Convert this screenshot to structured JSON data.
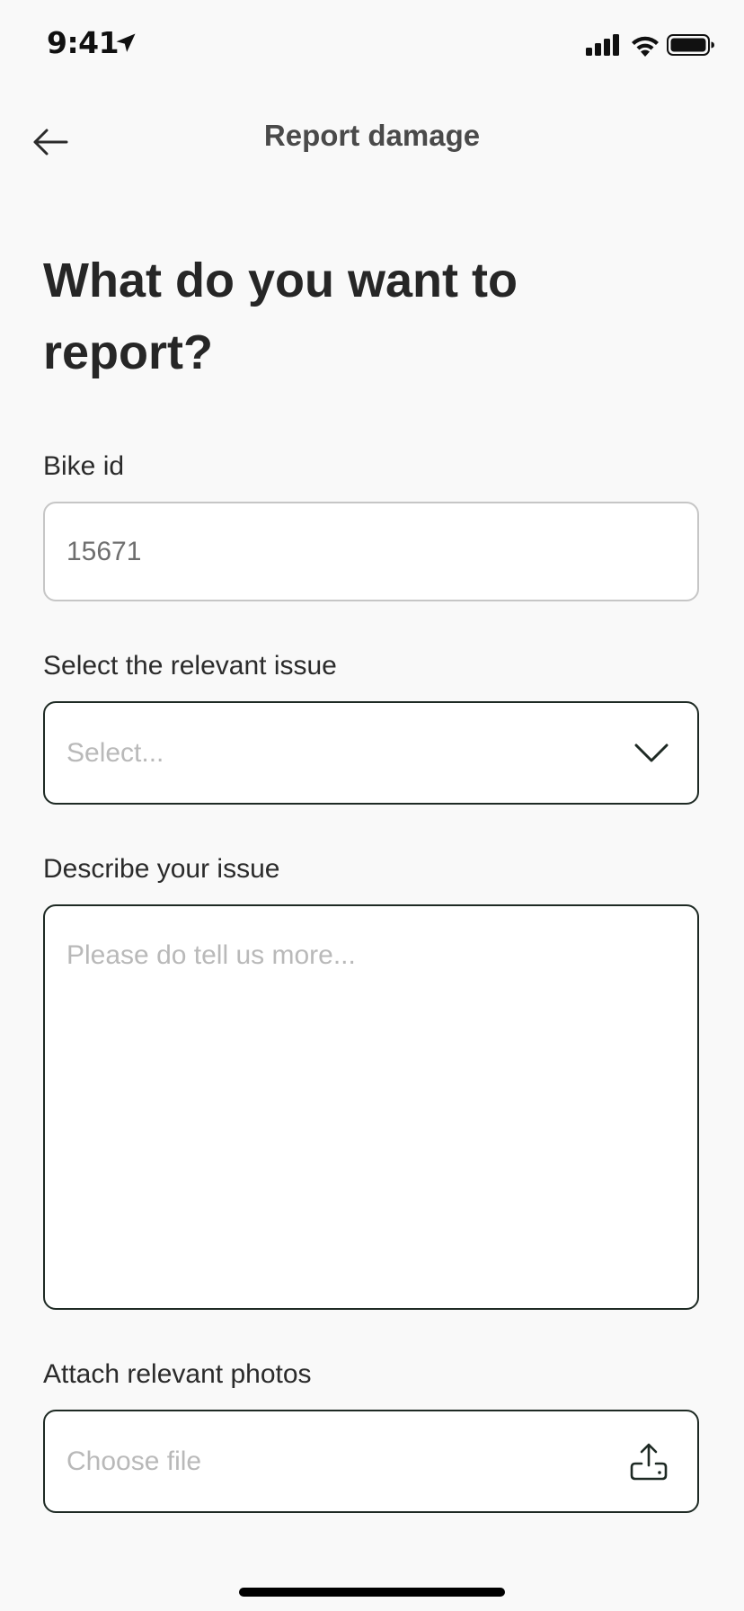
{
  "status_bar": {
    "time": "9:41"
  },
  "nav": {
    "title": "Report damage"
  },
  "heading": "What do you want to report?",
  "form": {
    "bike_id": {
      "label": "Bike id",
      "value": "15671"
    },
    "issue": {
      "label": "Select the relevant issue",
      "placeholder": "Select..."
    },
    "description": {
      "label": "Describe your issue",
      "placeholder": "Please do tell us more..."
    },
    "photos": {
      "label": "Attach relevant photos",
      "placeholder": "Choose file"
    }
  },
  "icons": {
    "back": "arrow-left-icon",
    "dropdown": "chevron-down-icon",
    "upload": "upload-icon",
    "location": "location-arrow-icon",
    "signal": "cellular-signal-icon",
    "wifi": "wifi-icon",
    "battery": "battery-icon"
  },
  "colors": {
    "background": "#f9f9f9",
    "text": "#262626",
    "border_active": "#1e2a24",
    "border_disabled": "#c6c6c6",
    "placeholder": "#b9b9b9"
  }
}
